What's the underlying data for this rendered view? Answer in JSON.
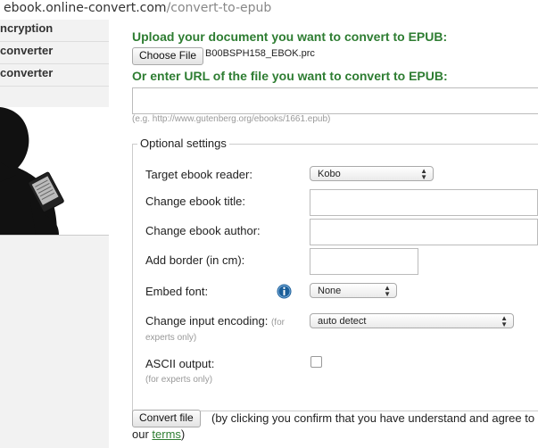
{
  "address_bar": {
    "host": "ebook.online-convert.com",
    "path": "/convert-to-epub"
  },
  "sidebar": {
    "items": [
      {
        "label": "ncryption"
      },
      {
        "label": "converter"
      },
      {
        "label": "converter"
      }
    ]
  },
  "upload": {
    "heading": "Upload your document you want to convert to EPUB:",
    "choose_file_label": "Choose File",
    "file_name": "B00BSPH158_EBOK.prc"
  },
  "url_section": {
    "heading": "Or enter URL of the file you want to convert to EPUB:",
    "value": "",
    "hint": "(e.g. http://www.gutenberg.org/ebooks/1661.epub)"
  },
  "optional": {
    "legend": "Optional settings",
    "target_reader": {
      "label": "Target ebook reader:",
      "value": "Kobo"
    },
    "title": {
      "label": "Change ebook title:",
      "value": ""
    },
    "author": {
      "label": "Change ebook author:",
      "value": ""
    },
    "border": {
      "label": "Add border (in cm):",
      "value": ""
    },
    "embed_font": {
      "label": "Embed font:",
      "value": "None"
    },
    "encoding": {
      "label": "Change input encoding:",
      "note1": "(for",
      "note2": "experts only)",
      "value": "auto detect"
    },
    "ascii": {
      "label": "ASCII output:",
      "note": "(for experts only)",
      "checked": false
    }
  },
  "footer": {
    "convert_label": "Convert file",
    "confirm_text": "(by clicking you confirm that you have understand and agree to our",
    "terms_link": "terms",
    "close_paren": ")"
  },
  "colors": {
    "heading_green": "#2e7d32",
    "info_icon_blue": "#1a5e99"
  }
}
